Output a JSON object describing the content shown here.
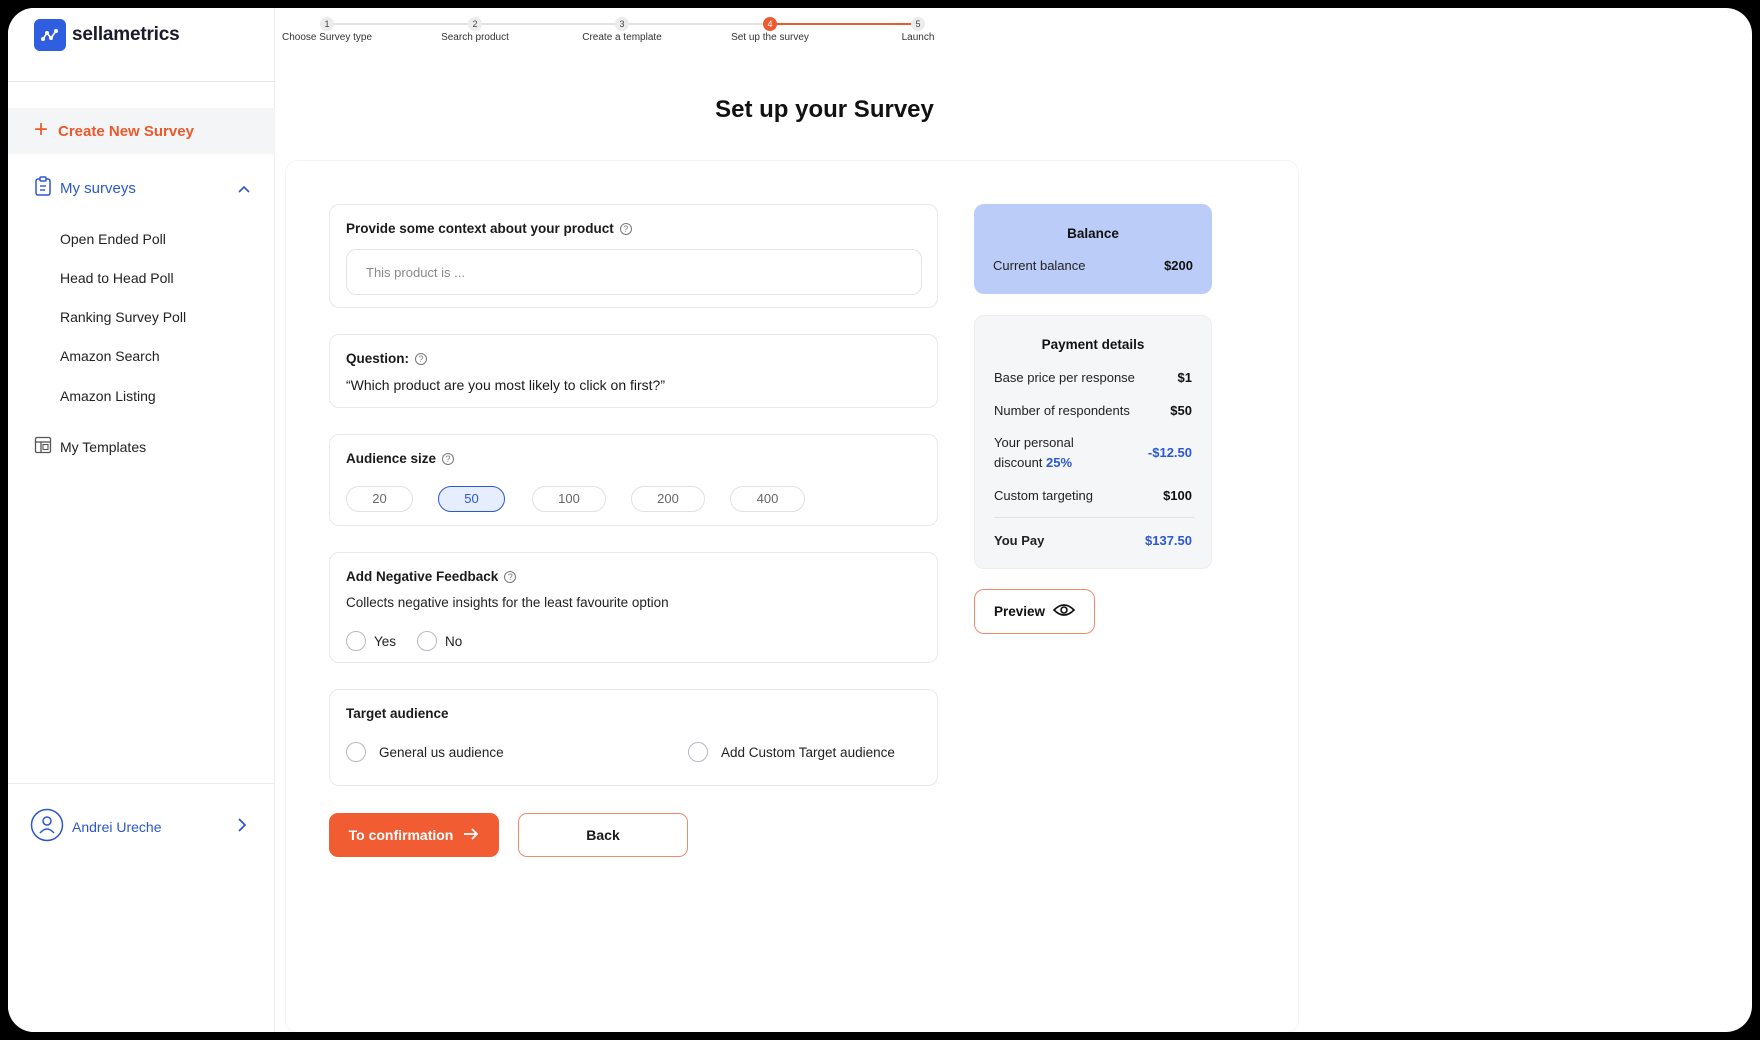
{
  "brand": {
    "name": "sellametrics",
    "accent": "#f15c33",
    "primary": "#2b58d0"
  },
  "sidebar": {
    "create_label": "Create New Survey",
    "my_surveys_label": "My surveys",
    "items": [
      "Open Ended Poll",
      "Head to Head Poll",
      "Ranking Survey Poll",
      "Amazon Search",
      "Amazon Listing"
    ],
    "templates_label": "My Templates",
    "user_name": "Andrei Ureche"
  },
  "stepper": {
    "steps": [
      {
        "num": "1",
        "label": "Choose Survey type"
      },
      {
        "num": "2",
        "label": "Search product"
      },
      {
        "num": "3",
        "label": "Create a template"
      },
      {
        "num": "4",
        "label": "Set up the survey"
      },
      {
        "num": "5",
        "label": "Launch"
      }
    ],
    "active_step": 4
  },
  "page_title": "Set up your Survey",
  "context": {
    "title": "Provide some context about your product",
    "placeholder": "This product is ..."
  },
  "question": {
    "title": "Question:",
    "text": "“Which product are you most likely to click on first?”"
  },
  "audience": {
    "title": "Audience size",
    "options": [
      "20",
      "50",
      "100",
      "200",
      "400"
    ],
    "selected": "50"
  },
  "negative": {
    "title": "Add Negative Feedback",
    "description": "Collects negative insights for the least favourite option",
    "yes": "Yes",
    "no": "No"
  },
  "target": {
    "title": "Target audience",
    "general": "General us audience",
    "custom": "Add Custom Target audience"
  },
  "buttons": {
    "confirm": "To confirmation",
    "back": "Back",
    "preview": "Preview"
  },
  "balance": {
    "title": "Balance",
    "label": "Current balance",
    "value": "$200"
  },
  "payment": {
    "title": "Payment details",
    "base_label": "Base price per response",
    "base_value": "$1",
    "respondents_label": "Number of respondents",
    "respondents_value": "$50",
    "discount_line1": "Your personal",
    "discount_line2": "discount",
    "discount_pct": "25%",
    "discount_value": "-$12.50",
    "targeting_label": "Custom targeting",
    "targeting_value": "$100",
    "pay_label": "You Pay",
    "pay_value": "$137.50"
  }
}
